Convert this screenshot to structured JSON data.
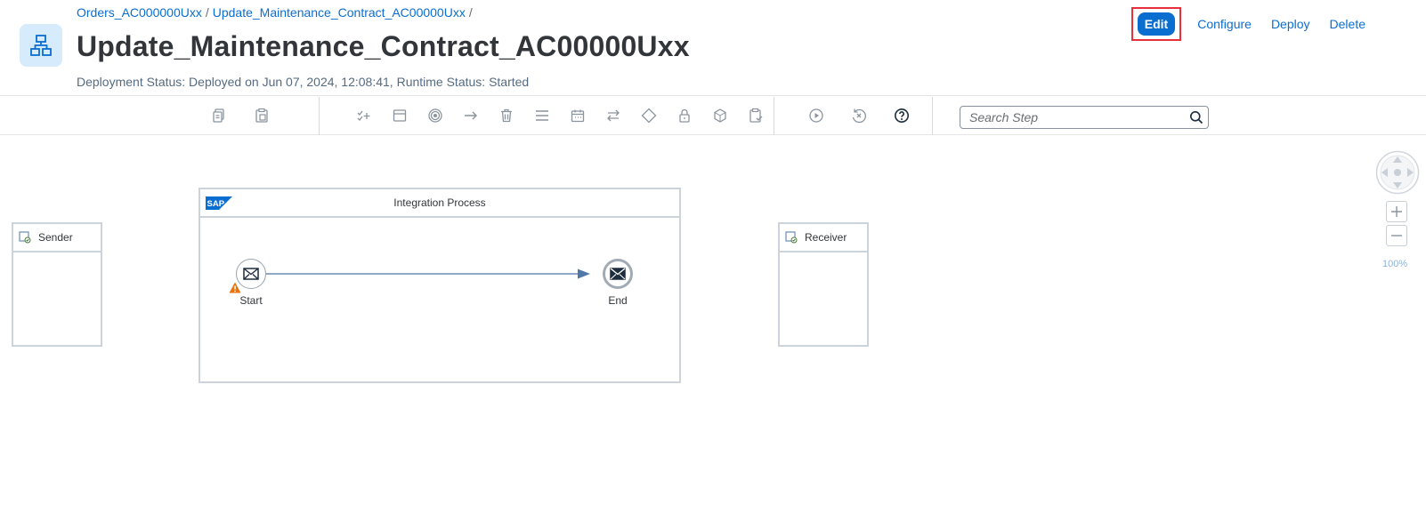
{
  "header": {
    "breadcrumb": [
      "Orders_AC000000Uxx",
      "Update_Maintenance_Contract_AC00000Uxx"
    ],
    "breadcrumb_separator": "/",
    "title": "Update_Maintenance_Contract_AC00000Uxx",
    "status_line": "Deployment Status: Deployed on Jun 07, 2024, 12:08:41, Runtime Status: Started",
    "app_icon": "hierarchy-icon",
    "actions": {
      "edit": "Edit",
      "configure": "Configure",
      "deploy": "Deploy",
      "delete": "Delete"
    }
  },
  "toolbar": {
    "icons": [
      "copy-icon",
      "paste-icon",
      "validation-add-icon",
      "call-icon",
      "event-icon",
      "mapping-arrow-icon",
      "delete-icon",
      "menu-icon",
      "calendar-icon",
      "exchange-icon",
      "gateway-icon",
      "lock-icon",
      "service-icon",
      "clipboard-check-icon",
      "play-icon",
      "reset-icon",
      "help-icon"
    ],
    "search_placeholder": "Search Step"
  },
  "diagram": {
    "sender_label": "Sender",
    "receiver_label": "Receiver",
    "process_title": "Integration Process",
    "sap_logo_text": "SAP",
    "start_label": "Start",
    "end_label": "End",
    "zoom_level": "100%"
  },
  "colors": {
    "accent": "#0a6ed1",
    "highlight_border": "#e8303d",
    "warning": "#e9730c"
  }
}
